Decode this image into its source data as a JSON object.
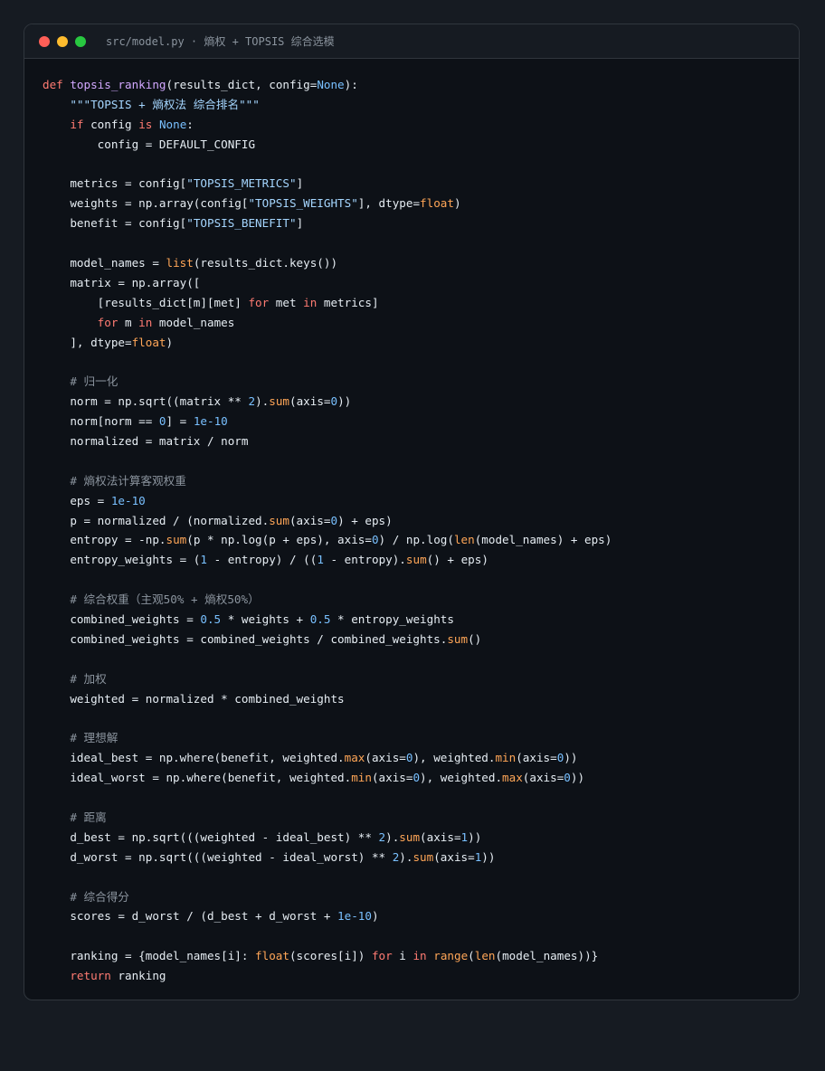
{
  "window": {
    "title": "src/model.py · 熵权 + TOPSIS 综合选模",
    "buttons": {
      "close_color": "#ff5f57",
      "minimize_color": "#febc2e",
      "maximize_color": "#28c840"
    }
  },
  "theme": {
    "keyword": "#ff7b72",
    "function": "#d2a8ff",
    "string": "#a5d6ff",
    "number": "#79c0ff",
    "builtin": "#ffa657",
    "comment": "#8b949e",
    "text": "#e6edf3"
  },
  "code_lines": [
    [
      {
        "t": "def",
        "c": "kw"
      },
      {
        "t": " "
      },
      {
        "t": "topsis_ranking",
        "c": "fn"
      },
      {
        "t": "(results_dict, config="
      },
      {
        "t": "None",
        "c": "con"
      },
      {
        "t": "):"
      }
    ],
    [
      {
        "t": "    "
      },
      {
        "t": "\"\"\"TOPSIS + 熵权法 综合排名\"\"\"",
        "c": "str"
      }
    ],
    [
      {
        "t": "    "
      },
      {
        "t": "if",
        "c": "kw"
      },
      {
        "t": " config "
      },
      {
        "t": "is",
        "c": "kw"
      },
      {
        "t": " "
      },
      {
        "t": "None",
        "c": "con"
      },
      {
        "t": ":"
      }
    ],
    [
      {
        "t": "        config = DEFAULT_CONFIG"
      }
    ],
    [],
    [
      {
        "t": "    metrics = config["
      },
      {
        "t": "\"TOPSIS_METRICS\"",
        "c": "str"
      },
      {
        "t": "]"
      }
    ],
    [
      {
        "t": "    weights = np.array(config["
      },
      {
        "t": "\"TOPSIS_WEIGHTS\"",
        "c": "str"
      },
      {
        "t": "], dtype="
      },
      {
        "t": "float",
        "c": "bi"
      },
      {
        "t": ")"
      }
    ],
    [
      {
        "t": "    benefit = config["
      },
      {
        "t": "\"TOPSIS_BENEFIT\"",
        "c": "str"
      },
      {
        "t": "]"
      }
    ],
    [],
    [
      {
        "t": "    model_names = "
      },
      {
        "t": "list",
        "c": "bi"
      },
      {
        "t": "(results_dict.keys())"
      }
    ],
    [
      {
        "t": "    matrix = np.array(["
      }
    ],
    [
      {
        "t": "        [results_dict[m][met] "
      },
      {
        "t": "for",
        "c": "kw"
      },
      {
        "t": " met "
      },
      {
        "t": "in",
        "c": "kw"
      },
      {
        "t": " metrics]"
      }
    ],
    [
      {
        "t": "        "
      },
      {
        "t": "for",
        "c": "kw"
      },
      {
        "t": " m "
      },
      {
        "t": "in",
        "c": "kw"
      },
      {
        "t": " model_names"
      }
    ],
    [
      {
        "t": "    ], dtype="
      },
      {
        "t": "float",
        "c": "bi"
      },
      {
        "t": ")"
      }
    ],
    [],
    [
      {
        "t": "    "
      },
      {
        "t": "# 归一化",
        "c": "cm"
      }
    ],
    [
      {
        "t": "    norm = np.sqrt((matrix ** "
      },
      {
        "t": "2",
        "c": "num"
      },
      {
        "t": ")."
      },
      {
        "t": "sum",
        "c": "bi"
      },
      {
        "t": "(axis="
      },
      {
        "t": "0",
        "c": "num"
      },
      {
        "t": "))"
      }
    ],
    [
      {
        "t": "    norm[norm == "
      },
      {
        "t": "0",
        "c": "num"
      },
      {
        "t": "] = "
      },
      {
        "t": "1e-10",
        "c": "num"
      }
    ],
    [
      {
        "t": "    normalized = matrix / norm"
      }
    ],
    [],
    [
      {
        "t": "    "
      },
      {
        "t": "# 熵权法计算客观权重",
        "c": "cm"
      }
    ],
    [
      {
        "t": "    eps = "
      },
      {
        "t": "1e-10",
        "c": "num"
      }
    ],
    [
      {
        "t": "    p = normalized / (normalized."
      },
      {
        "t": "sum",
        "c": "bi"
      },
      {
        "t": "(axis="
      },
      {
        "t": "0",
        "c": "num"
      },
      {
        "t": ") + eps)"
      }
    ],
    [
      {
        "t": "    entropy = -np."
      },
      {
        "t": "sum",
        "c": "bi"
      },
      {
        "t": "(p * np.log(p + eps), axis="
      },
      {
        "t": "0",
        "c": "num"
      },
      {
        "t": ") / np.log("
      },
      {
        "t": "len",
        "c": "bi"
      },
      {
        "t": "(model_names) + eps)"
      }
    ],
    [
      {
        "t": "    entropy_weights = ("
      },
      {
        "t": "1",
        "c": "num"
      },
      {
        "t": " - entropy) / (("
      },
      {
        "t": "1",
        "c": "num"
      },
      {
        "t": " - entropy)."
      },
      {
        "t": "sum",
        "c": "bi"
      },
      {
        "t": "() + eps)"
      }
    ],
    [],
    [
      {
        "t": "    "
      },
      {
        "t": "# 综合权重（主观50% + 熵权50%）",
        "c": "cm"
      }
    ],
    [
      {
        "t": "    combined_weights = "
      },
      {
        "t": "0.5",
        "c": "num"
      },
      {
        "t": " * weights + "
      },
      {
        "t": "0.5",
        "c": "num"
      },
      {
        "t": " * entropy_weights"
      }
    ],
    [
      {
        "t": "    combined_weights = combined_weights / combined_weights."
      },
      {
        "t": "sum",
        "c": "bi"
      },
      {
        "t": "()"
      }
    ],
    [],
    [
      {
        "t": "    "
      },
      {
        "t": "# 加权",
        "c": "cm"
      }
    ],
    [
      {
        "t": "    weighted = normalized * combined_weights"
      }
    ],
    [],
    [
      {
        "t": "    "
      },
      {
        "t": "# 理想解",
        "c": "cm"
      }
    ],
    [
      {
        "t": "    ideal_best = np.where(benefit, weighted."
      },
      {
        "t": "max",
        "c": "bi"
      },
      {
        "t": "(axis="
      },
      {
        "t": "0",
        "c": "num"
      },
      {
        "t": "), weighted."
      },
      {
        "t": "min",
        "c": "bi"
      },
      {
        "t": "(axis="
      },
      {
        "t": "0",
        "c": "num"
      },
      {
        "t": "))"
      }
    ],
    [
      {
        "t": "    ideal_worst = np.where(benefit, weighted."
      },
      {
        "t": "min",
        "c": "bi"
      },
      {
        "t": "(axis="
      },
      {
        "t": "0",
        "c": "num"
      },
      {
        "t": "), weighted."
      },
      {
        "t": "max",
        "c": "bi"
      },
      {
        "t": "(axis="
      },
      {
        "t": "0",
        "c": "num"
      },
      {
        "t": "))"
      }
    ],
    [],
    [
      {
        "t": "    "
      },
      {
        "t": "# 距离",
        "c": "cm"
      }
    ],
    [
      {
        "t": "    d_best = np.sqrt(((weighted - ideal_best) ** "
      },
      {
        "t": "2",
        "c": "num"
      },
      {
        "t": ")."
      },
      {
        "t": "sum",
        "c": "bi"
      },
      {
        "t": "(axis="
      },
      {
        "t": "1",
        "c": "num"
      },
      {
        "t": "))"
      }
    ],
    [
      {
        "t": "    d_worst = np.sqrt(((weighted - ideal_worst) ** "
      },
      {
        "t": "2",
        "c": "num"
      },
      {
        "t": ")."
      },
      {
        "t": "sum",
        "c": "bi"
      },
      {
        "t": "(axis="
      },
      {
        "t": "1",
        "c": "num"
      },
      {
        "t": "))"
      }
    ],
    [],
    [
      {
        "t": "    "
      },
      {
        "t": "# 综合得分",
        "c": "cm"
      }
    ],
    [
      {
        "t": "    scores = d_worst / (d_best + d_worst + "
      },
      {
        "t": "1e-10",
        "c": "num"
      },
      {
        "t": ")"
      }
    ],
    [],
    [
      {
        "t": "    ranking = {model_names[i]: "
      },
      {
        "t": "float",
        "c": "bi"
      },
      {
        "t": "(scores[i]) "
      },
      {
        "t": "for",
        "c": "kw"
      },
      {
        "t": " i "
      },
      {
        "t": "in",
        "c": "kw"
      },
      {
        "t": " "
      },
      {
        "t": "range",
        "c": "bi"
      },
      {
        "t": "("
      },
      {
        "t": "len",
        "c": "bi"
      },
      {
        "t": "(model_names))}"
      }
    ],
    [
      {
        "t": "    "
      },
      {
        "t": "return",
        "c": "kw"
      },
      {
        "t": " ranking"
      }
    ]
  ]
}
